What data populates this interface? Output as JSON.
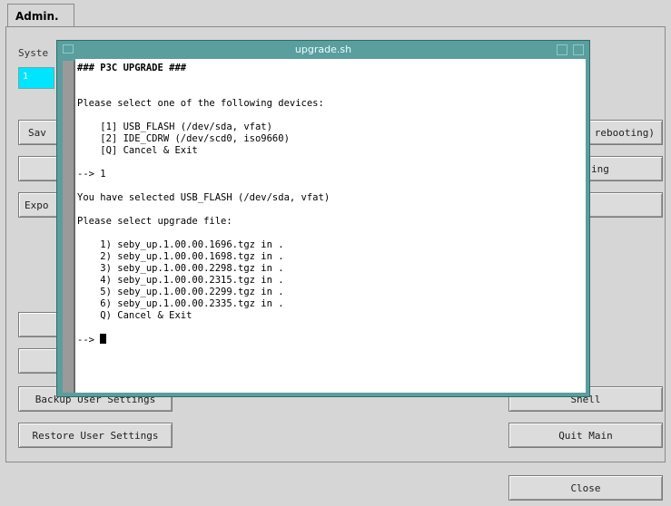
{
  "tabs": {
    "admin": "Admin."
  },
  "labels": {
    "system": "Syste",
    "cyan_value": "1"
  },
  "buttons": {
    "sav": "Sav",
    "expo": "Expo",
    "rebooting": "rebooting)",
    "ing": "ing",
    "backup": "Backup User Settings",
    "restore": "Restore User Settings",
    "shell": "Shell",
    "quit": "Quit Main",
    "close": "Close"
  },
  "terminal": {
    "title": "upgrade.sh",
    "lines": [
      "### P3C UPGRADE ###",
      "",
      "",
      "Please select one of the following devices:",
      "",
      "    [1] USB_FLASH (/dev/sda, vfat)",
      "    [2] IDE_CDRW (/dev/scd0, iso9660)",
      "    [Q] Cancel & Exit",
      "",
      "--> 1",
      "",
      "You have selected USB_FLASH (/dev/sda, vfat)",
      "",
      "Please select upgrade file:",
      "",
      "    1) seby_up.1.00.00.1696.tgz in .",
      "    2) seby_up.1.00.00.1698.tgz in .",
      "    3) seby_up.1.00.00.2298.tgz in .",
      "    4) seby_up.1.00.00.2315.tgz in .",
      "    5) seby_up.1.00.00.2299.tgz in .",
      "    6) seby_up.1.00.00.2335.tgz in .",
      "    Q) Cancel & Exit",
      "",
      "--> "
    ]
  },
  "colors": {
    "window": "#5a9e9e",
    "accent": "#00e5ff"
  }
}
